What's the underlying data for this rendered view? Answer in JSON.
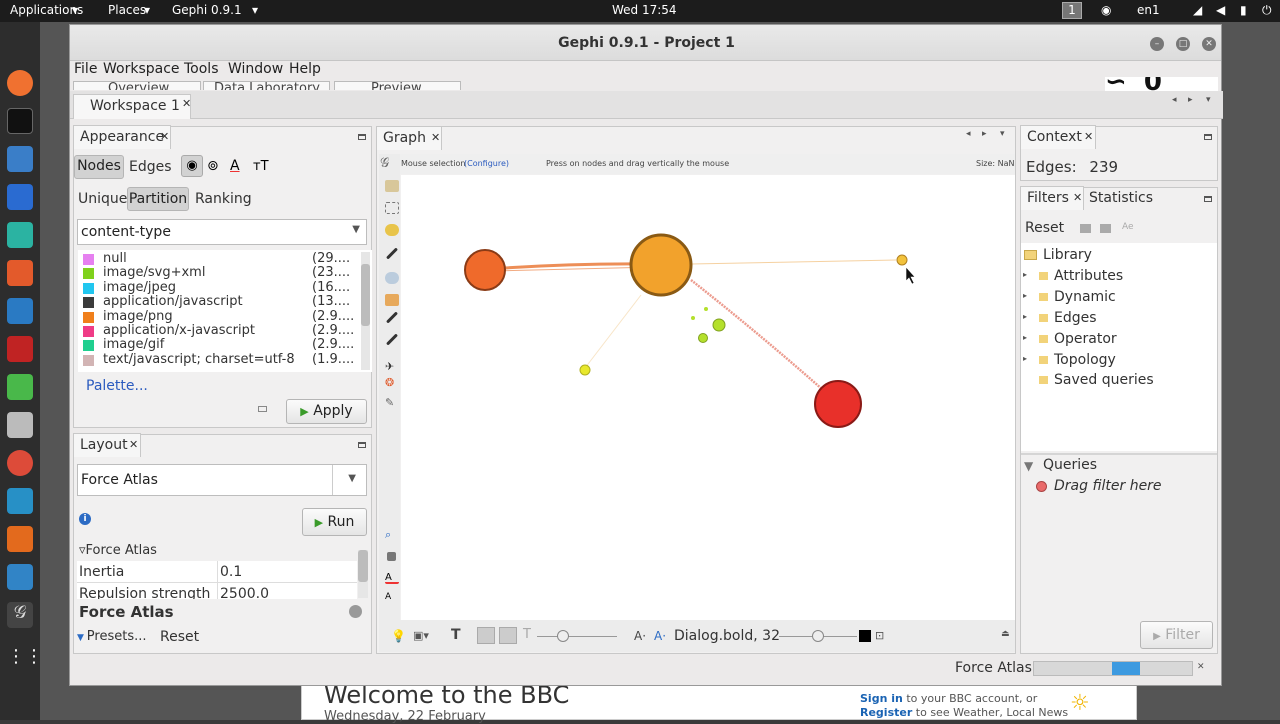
{
  "topbar": {
    "applications": "Applications",
    "places": "Places",
    "app": "Gephi 0.9.1",
    "clock": "Wed 17:54",
    "workspace_num": "1",
    "lang": "en1"
  },
  "window": {
    "title": "Gephi 0.9.1 - Project 1"
  },
  "menu": [
    "File",
    "Workspace",
    "Tools",
    "Window",
    "Help"
  ],
  "perspective_tabs": [
    "Overview",
    "Data Laboratory",
    "Preview"
  ],
  "workspace_tab": "Workspace 1",
  "appearance": {
    "tab": "Appearance",
    "nodes": "Nodes",
    "edges": "Edges",
    "subtabs": [
      "Unique",
      "Partition",
      "Ranking"
    ],
    "attribute": "content-type",
    "partitions": [
      {
        "label": "null",
        "count": "(29....",
        "color": "#e680f0"
      },
      {
        "label": "image/svg+xml",
        "count": "(23....",
        "color": "#7fd11c"
      },
      {
        "label": "image/jpeg",
        "count": "(16....",
        "color": "#21c6ef"
      },
      {
        "label": "application/javascript",
        "count": "(13....",
        "color": "#3b3b3b"
      },
      {
        "label": "image/png",
        "count": "(2.9....",
        "color": "#f07f1b"
      },
      {
        "label": "application/x-javascript",
        "count": "(2.9....",
        "color": "#ef3b86"
      },
      {
        "label": "image/gif",
        "count": "(2.9....",
        "color": "#1fcf8f"
      },
      {
        "label": "text/javascript; charset=utf-8",
        "count": "(1.9....",
        "color": "#d2b4b4"
      }
    ],
    "palette": "Palette...",
    "apply": "Apply"
  },
  "layout": {
    "tab": "Layout",
    "algorithm": "Force Atlas",
    "run": "Run",
    "section": "Force Atlas",
    "props": [
      {
        "name": "Inertia",
        "value": "0.1"
      },
      {
        "name": "Repulsion strength",
        "value": "2500.0"
      }
    ],
    "footer_title": "Force Atlas",
    "presets": "Presets...",
    "reset": "Reset"
  },
  "graph": {
    "tab": "Graph",
    "mouse_selection": "Mouse selection",
    "configure": "(Configure)",
    "hint": "Press on nodes and drag vertically the mouse",
    "size": "Size: NaN",
    "font_label": "Dialog.bold, 32"
  },
  "context": {
    "tab": "Context",
    "edges_label": "Edges:",
    "edges_value": "239"
  },
  "filters": {
    "tab": "Filters",
    "stats_tab": "Statistics",
    "reset": "Reset",
    "library": "Library",
    "tree": [
      "Attributes",
      "Dynamic",
      "Edges",
      "Operator",
      "Topology"
    ],
    "saved": "Saved queries",
    "queries": "Queries",
    "drag_hint": "Drag filter here",
    "filter_btn": "Filter"
  },
  "status": {
    "task": "Force Atlas"
  },
  "bbc": {
    "title": "Welcome to the BBC",
    "date": "Wednesday, 22 February",
    "signin": "Sign in",
    "signin_rest": "to your BBC account, or",
    "register": "Register",
    "register_rest": "to see Weather, Local News"
  }
}
